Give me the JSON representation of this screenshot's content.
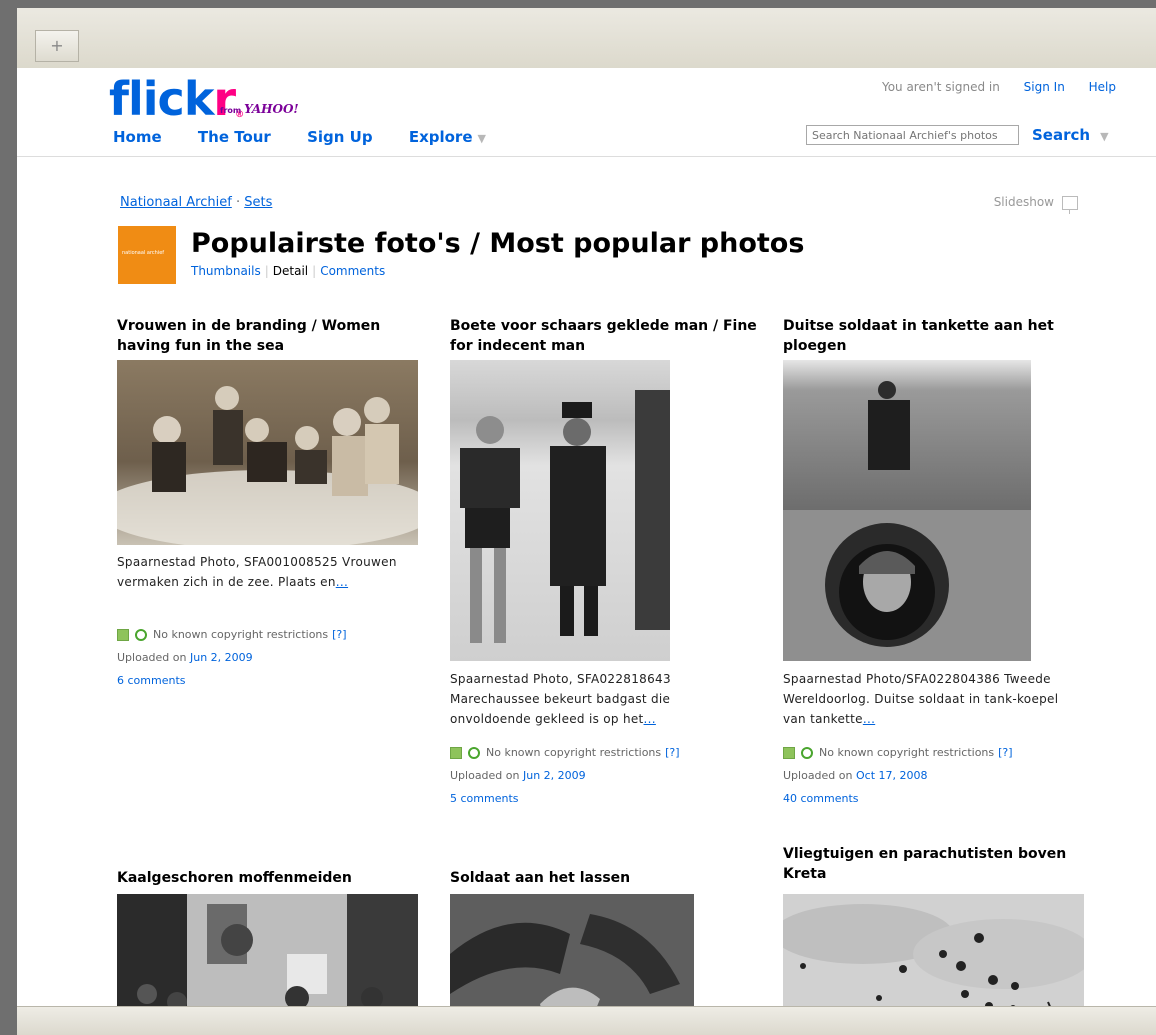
{
  "browser": {
    "new_tab_symbol": "+"
  },
  "header": {
    "logo_flick": "flick",
    "logo_r": "r",
    "logo_reg": "®",
    "logo_from": "from",
    "logo_yahoo": "YAHOO!",
    "signin_status": "You aren't signed in",
    "sign_in": "Sign In",
    "help": "Help",
    "nav": [
      "Home",
      "The Tour",
      "Sign Up",
      "Explore"
    ],
    "search_placeholder": "Search Nationaal Archief's photos",
    "search_button": "Search"
  },
  "breadcrumb": {
    "owner": "Nationaal Archief",
    "separator": "·",
    "sets": "Sets"
  },
  "slideshow_label": "Slideshow",
  "set": {
    "icon_text": "nationaal archief",
    "title": "Populairste foto's / Most popular photos",
    "views": [
      "Thumbnails",
      "Detail",
      "Comments"
    ]
  },
  "license_text": "No known copyright restrictions",
  "license_help": "[?]",
  "uploaded_prefix": "Uploaded on",
  "photos": [
    {
      "title": "Vrouwen in de branding / Women having fun in the sea",
      "desc": "Spaarnestad Photo, SFA001008525 Vrouwen vermaken zich in de zee. Plaats en",
      "more": "...",
      "date": "Jun 2, 2009",
      "comments": "6 comments"
    },
    {
      "title": "Boete voor schaars geklede man / Fine for indecent man",
      "desc": "Spaarnestad Photo, SFA022818643 Marechaussee bekeurt badgast die onvoldoende gekleed is op het",
      "more": "...",
      "date": "Jun 2, 2009",
      "comments": "5 comments"
    },
    {
      "title": "Duitse soldaat in tankette aan het ploegen",
      "desc": "Spaarnestad Photo/SFA022804386 Tweede Wereldoorlog. Duitse soldaat in tank-koepel van tankette",
      "more": "...",
      "date": "Oct 17, 2008",
      "comments": "40 comments"
    },
    {
      "title": "Kaalgeschoren moffenmeiden"
    },
    {
      "title": "Soldaat aan het lassen"
    },
    {
      "title": "Vliegtuigen en parachutisten boven Kreta"
    }
  ],
  "colors": {
    "flickr_blue": "#0063dc",
    "flickr_pink": "#ff0084",
    "link": "#0063dc",
    "set_icon": "#f08c14"
  }
}
